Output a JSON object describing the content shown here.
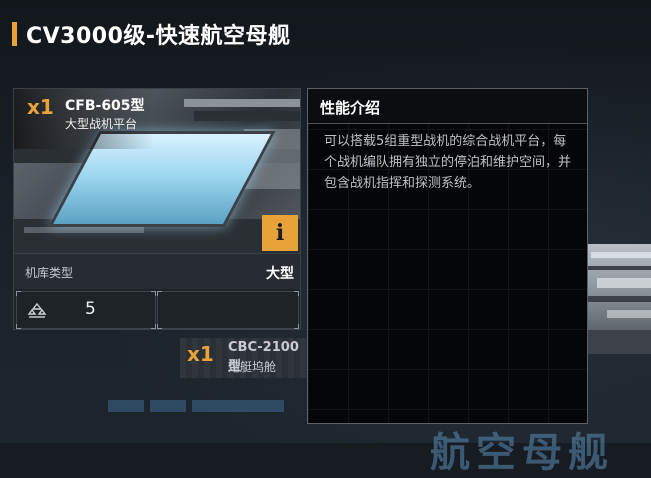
{
  "page": {
    "title": "CV3000级-快速航空母舰"
  },
  "hangar_card": {
    "multiplier": "x1",
    "code": "CFB-605型",
    "subtitle": "大型战机平台",
    "info_button": "i",
    "hangar_type_label": "机库类型",
    "hangar_type_value": "大型",
    "craft_count": "5",
    "craft_icon": "aircraft-group-icon"
  },
  "secondary_card": {
    "multiplier": "x1",
    "code": "CBC-2100型",
    "subtitle": "炮艇坞舱"
  },
  "info_panel": {
    "title": "性能介绍",
    "description": "可以搭载5组重型战机的综合战机平台，每个战机编队拥有独立的停泊和维护空间，并包含战机指挥和探测系统。"
  },
  "background": {
    "faded_text": "航空母舰"
  },
  "colors": {
    "accent": "#e8a23a",
    "panel_bg": "#050607",
    "page_bg": "#171c22"
  }
}
